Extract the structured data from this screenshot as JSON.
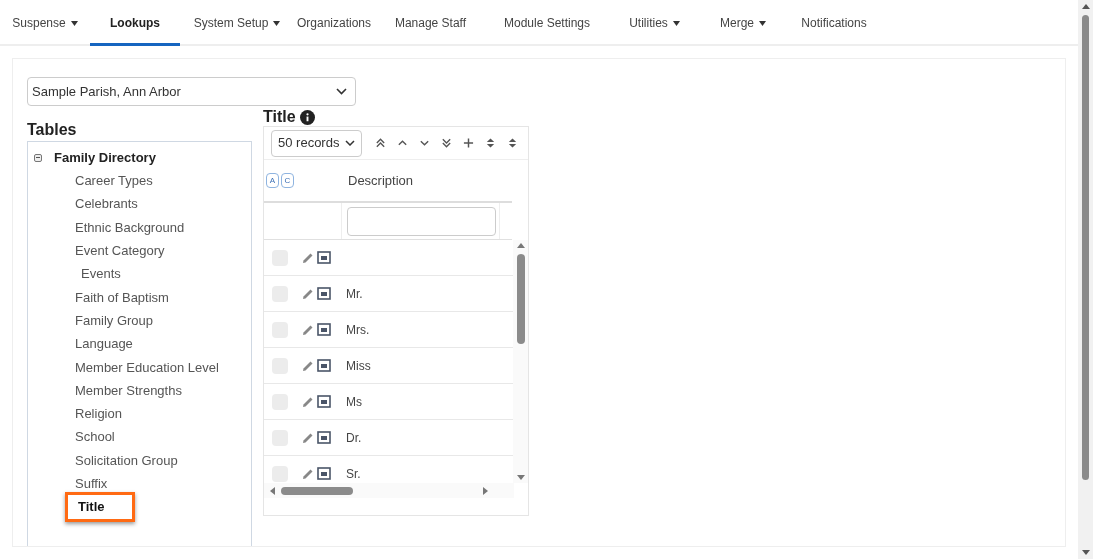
{
  "nav": [
    {
      "label": "Suspense",
      "has_menu": true,
      "selected": false
    },
    {
      "label": "Lookups",
      "has_menu": false,
      "selected": true
    },
    {
      "label": "System Setup",
      "has_menu": true,
      "selected": false
    },
    {
      "label": "Organizations",
      "has_menu": false,
      "selected": false
    },
    {
      "label": "Manage Staff",
      "has_menu": false,
      "selected": false
    },
    {
      "label": "Module Settings",
      "has_menu": false,
      "selected": false
    },
    {
      "label": "Utilities",
      "has_menu": true,
      "selected": false
    },
    {
      "label": "Merge",
      "has_menu": true,
      "selected": false
    },
    {
      "label": "Notifications",
      "has_menu": false,
      "selected": false
    }
  ],
  "organization_select": {
    "value": "Sample Parish, Ann Arbor"
  },
  "tables": {
    "heading": "Tables",
    "tree": [
      {
        "label": "Family Directory",
        "expanded": true,
        "selected": false,
        "children": [
          {
            "label": "Career Types",
            "selected": false
          },
          {
            "label": "Celebrants",
            "selected": false
          },
          {
            "label": "Ethnic Background",
            "selected": false
          },
          {
            "label": "Event Category",
            "selected": false,
            "children": [
              {
                "label": "Events",
                "selected": false
              }
            ]
          },
          {
            "label": "Faith of Baptism",
            "selected": false
          },
          {
            "label": "Family Group",
            "selected": false
          },
          {
            "label": "Language",
            "selected": false
          },
          {
            "label": "Member Education Level",
            "selected": false
          },
          {
            "label": "Member Strengths",
            "selected": false
          },
          {
            "label": "Religion",
            "selected": false
          },
          {
            "label": "School",
            "selected": false
          },
          {
            "label": "Solicitation Group",
            "selected": false
          },
          {
            "label": "Suffix",
            "selected": false
          },
          {
            "label": "Title",
            "selected": true
          }
        ]
      }
    ]
  },
  "grid": {
    "title": "Title",
    "page_size": "50 records",
    "badges": [
      "A",
      "C"
    ],
    "columns": [
      "Description"
    ],
    "rows": [
      {
        "description": "",
        "checked": false
      },
      {
        "description": "Mr.",
        "checked": false
      },
      {
        "description": "Mrs.",
        "checked": false
      },
      {
        "description": "Miss",
        "checked": false
      },
      {
        "description": "Ms",
        "checked": false
      },
      {
        "description": "Dr.",
        "checked": false
      },
      {
        "description": "Sr.",
        "checked": false
      }
    ]
  }
}
